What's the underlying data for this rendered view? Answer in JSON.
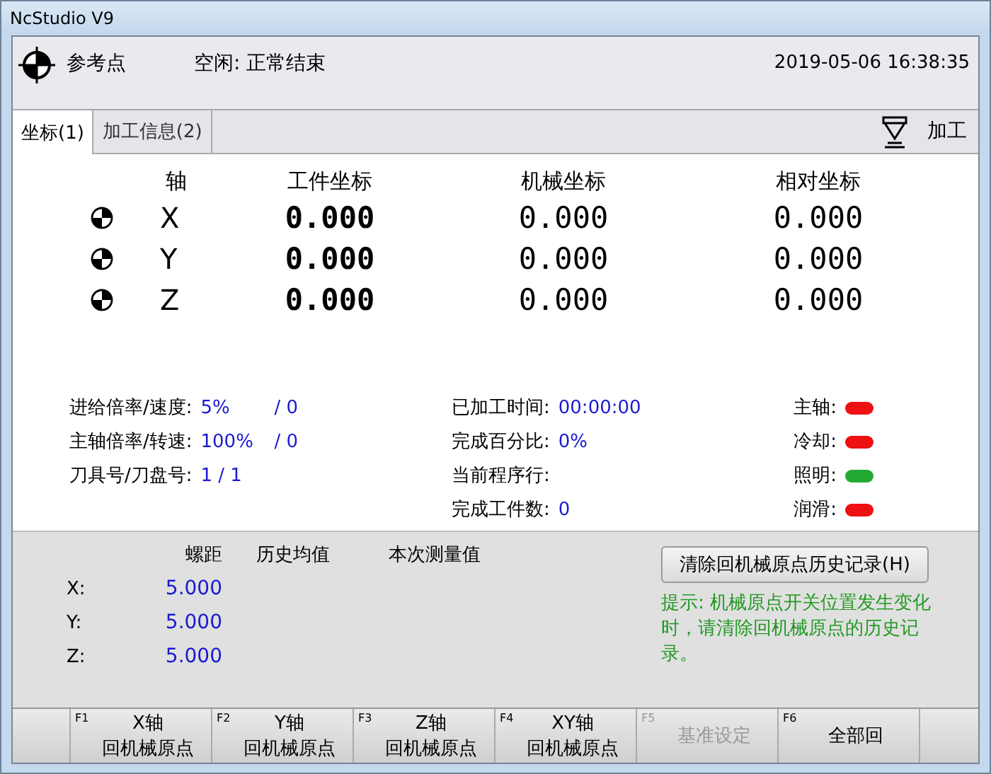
{
  "window": {
    "title": "NcStudio V9"
  },
  "header": {
    "position_label": "参考点",
    "status": "空闲: 正常结束",
    "datetime": "2019-05-06 16:38:35"
  },
  "tabs": [
    {
      "label": "坐标(1)",
      "selected": true
    },
    {
      "label": "加工信息(2)",
      "selected": false
    }
  ],
  "process_button": "加工",
  "coordinates": {
    "columns": [
      "轴",
      "工件坐标",
      "机械坐标",
      "相对坐标"
    ],
    "rows": [
      {
        "axis": "X",
        "work": "0.000",
        "machine": "0.000",
        "relative": "0.000"
      },
      {
        "axis": "Y",
        "work": "0.000",
        "machine": "0.000",
        "relative": "0.000"
      },
      {
        "axis": "Z",
        "work": "0.000",
        "machine": "0.000",
        "relative": "0.000"
      }
    ]
  },
  "info_left": [
    {
      "label": "进给倍率/速度:",
      "value": "5%",
      "extra": "/ 0"
    },
    {
      "label": "主轴倍率/转速:",
      "value": "100%",
      "extra": "/ 0"
    },
    {
      "label": "刀具号/刀盘号:",
      "value": "1 / 1"
    }
  ],
  "info_middle": [
    {
      "label": "已加工时间:",
      "value": "00:00:00"
    },
    {
      "label": "完成百分比:",
      "value": "0%"
    },
    {
      "label": "当前程序行:"
    },
    {
      "label": "完成工件数:",
      "value": "0"
    }
  ],
  "lights": [
    {
      "label": "主轴:",
      "color": "#ee1111"
    },
    {
      "label": "冷却:",
      "color": "#ee1111"
    },
    {
      "label": "照明:",
      "color": "#22aa33"
    },
    {
      "label": "润滑:",
      "color": "#ee1111"
    }
  ],
  "pitch": {
    "columns": [
      "螺距",
      "历史均值",
      "本次测量值"
    ],
    "rows": [
      {
        "axis": "X:",
        "pitch": "5.000"
      },
      {
        "axis": "Y:",
        "pitch": "5.000"
      },
      {
        "axis": "Z:",
        "pitch": "5.000"
      }
    ]
  },
  "clear_button": "清除回机械原点历史记录(H)",
  "hint": "提示: 机械原点开关位置发生变化时，请清除回机械原点的历史记录。",
  "function_keys": [
    {
      "key": "F1",
      "line1": "X轴",
      "line2": "回机械原点",
      "disabled": false
    },
    {
      "key": "F2",
      "line1": "Y轴",
      "line2": "回机械原点",
      "disabled": false
    },
    {
      "key": "F3",
      "line1": "Z轴",
      "line2": "回机械原点",
      "disabled": false
    },
    {
      "key": "F4",
      "line1": "XY轴",
      "line2": "回机械原点",
      "disabled": false
    },
    {
      "key": "F5",
      "line1": "基准设定",
      "disabled": true
    },
    {
      "key": "F6",
      "line1": "全部回",
      "disabled": false
    }
  ]
}
